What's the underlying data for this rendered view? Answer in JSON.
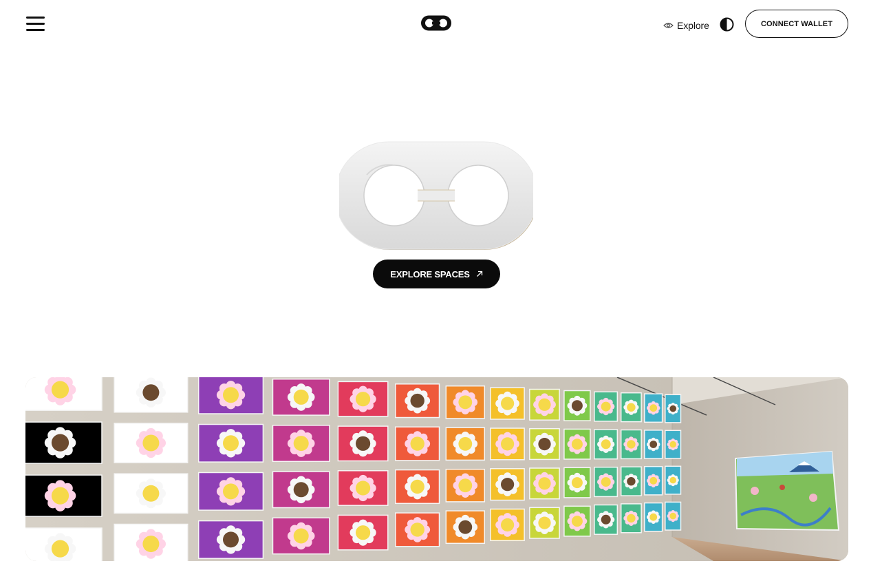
{
  "header": {
    "menu_icon": "hamburger-menu-icon",
    "logo_icon": "infinity-logo-icon",
    "explore_label": "Explore",
    "explore_icon": "eye-icon",
    "theme_icon": "contrast-toggle-icon",
    "connect_wallet_label": "CONNECT WALLET"
  },
  "hero": {
    "logo_icon": "infinity-logo-3d",
    "cta_label": "EXPLORE SPACES",
    "cta_icon": "arrow-up-right-icon"
  },
  "gallery": {
    "image": "virtual-gallery-room-with-pixel-flower-artworks"
  },
  "colors": {
    "text": "#111111",
    "button_dark": "#0b0b0b",
    "background": "#ffffff"
  }
}
